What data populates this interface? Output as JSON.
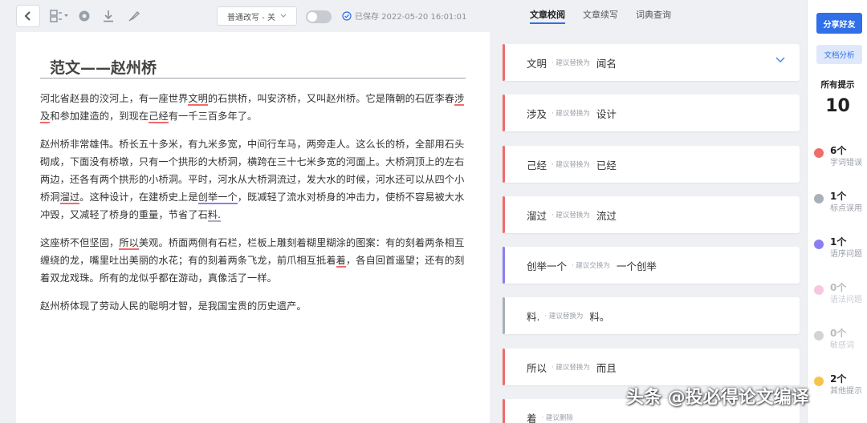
{
  "toolbar": {
    "mode_select": "普通改写 - 关",
    "saved_text": "已保存 2022-05-20 16:01:01",
    "tabs": [
      "文章校阅",
      "文章续写",
      "词典查询"
    ]
  },
  "document": {
    "title": "范文——赵州桥",
    "p1": {
      "a": "河北省赵县的洨河上，有一座世界",
      "e1": "文明",
      "b": "的石拱桥，叫安济桥，又叫赵州桥。它是隋朝的石匠李春",
      "e2": "涉及",
      "c": "和参加建造的，到现在",
      "e3": "己经",
      "d": "有一千三百多年了。"
    },
    "p2": {
      "a": "赵州桥非常雄伟。桥长五十多米，有九米多宽，中间行车马，两旁走人。这么长的桥，全部用石头砌成，下面没有桥墩，只有一个拱形的大桥洞，横跨在三十七米多宽的河面上。大桥洞顶上的左右两边，还各有两个拱形的小桥洞。平时，河水从大桥洞流过，发大水的时候，河水还可以从四个小桥洞",
      "e1": "溜过",
      "b": "。这种设计，在建桥史上是",
      "e2": "创举一个",
      "c": "，既减轻了流水对桥身的冲击力，使桥不容易被大水冲毁，又减轻了桥身的重量，节省了石",
      "e3": "料.",
      "d": ""
    },
    "p3": {
      "a": "这座桥不但坚固，",
      "e1": "所以",
      "b": "美观。桥面两侧有石栏，栏板上雕刻着糊里糊涂的图案：有的刻着两条相互缠绕的龙，嘴里吐出美丽的水花；有的刻着两条飞龙，前爪相互抵着",
      "e2": "着",
      "c": "，各自回首遥望；还有的刻着双龙戏珠。所有的龙似乎都在游动，真像活了一样。"
    },
    "p4": "赵州桥体现了劳动人民的聪明才智，是我国宝贵的历史遗产。"
  },
  "suggestions": [
    {
      "original": "文明",
      "hint": "· 建议替换为",
      "replacement": "闻名",
      "color": "#f06b6b"
    },
    {
      "original": "涉及",
      "hint": "· 建议替换为",
      "replacement": "设计",
      "color": "#f06b6b"
    },
    {
      "original": "己经",
      "hint": "· 建议替换为",
      "replacement": "已经",
      "color": "#f06b6b"
    },
    {
      "original": "溜过",
      "hint": "· 建议替换为",
      "replacement": "流过",
      "color": "#f06b6b"
    },
    {
      "original": "创举一个",
      "hint": "· 建议交换为",
      "replacement": "一个创举",
      "color": "#8c7ef0"
    },
    {
      "original": "料.",
      "hint": "· 建议替换为",
      "replacement": "料。",
      "color": "#aab0b8"
    },
    {
      "original": "所以",
      "hint": "· 建议替换为",
      "replacement": "而且",
      "color": "#f06b6b"
    },
    {
      "original": "着",
      "hint": "· 建议删除",
      "replacement": "",
      "color": "#f06b6b"
    }
  ],
  "sidebar": {
    "share_label": "分享好友",
    "analysis_label": "文档分析",
    "all_label": "所有提示",
    "all_count": "10",
    "stats": [
      {
        "count": "6个",
        "label": "字词错误",
        "color": "#f06b6b"
      },
      {
        "count": "1个",
        "label": "标点误用",
        "color": "#aab0b8"
      },
      {
        "count": "1个",
        "label": "语序问题",
        "color": "#8c7ef0"
      },
      {
        "count": "0个",
        "label": "语法问题",
        "color": "#f7c6e0"
      },
      {
        "count": "0个",
        "label": "敏感词",
        "color": "#d0d3d8"
      },
      {
        "count": "2个",
        "label": "其他提示",
        "color": "#f5c44d"
      }
    ]
  },
  "watermark": "头条 @投必得论文编译",
  "colors": {
    "accent": "#2f6fe8",
    "error": "#f06b6b",
    "order": "#8c7ef0",
    "punct": "#aab0b8"
  }
}
